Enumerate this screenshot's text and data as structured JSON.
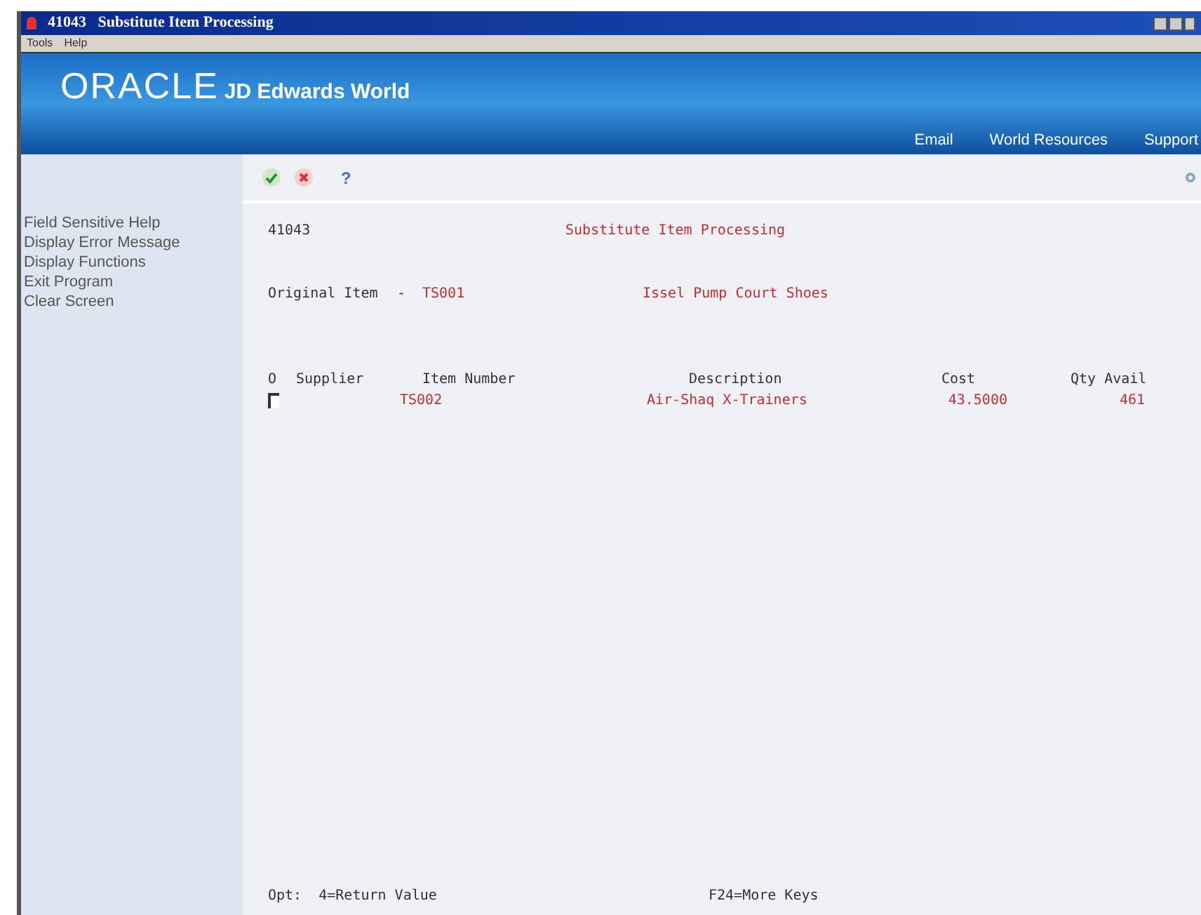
{
  "window": {
    "title": "41043   Substitute Item Processing"
  },
  "menu": [
    "Tools",
    "Help"
  ],
  "banner": {
    "logo": "ORACLE",
    "product": "JD Edwards World",
    "links": [
      "Email",
      "World Resources",
      "Support"
    ]
  },
  "toolbar": {
    "help": "?"
  },
  "sidebar": {
    "items": [
      "Field Sensitive Help",
      "Display Error Message",
      "Display Functions",
      "Exit Program",
      "Clear Screen"
    ]
  },
  "form": {
    "number": "41043",
    "title": "Substitute Item Processing",
    "original_label": "Original Item",
    "separator": "-",
    "original_item": "TS001",
    "original_description": "Issel Pump Court Shoes"
  },
  "table": {
    "columns": [
      "O",
      "Supplier",
      "Item Number",
      "Description",
      "Cost",
      "Qty Avail"
    ],
    "rows": [
      {
        "item_number": "TS002",
        "description": "Air-Shaq X-Trainers",
        "cost": "43.5000",
        "qty": "461"
      }
    ]
  },
  "footer": {
    "options": "Opt:  4=Return Value",
    "keys": "F24=More Keys"
  }
}
